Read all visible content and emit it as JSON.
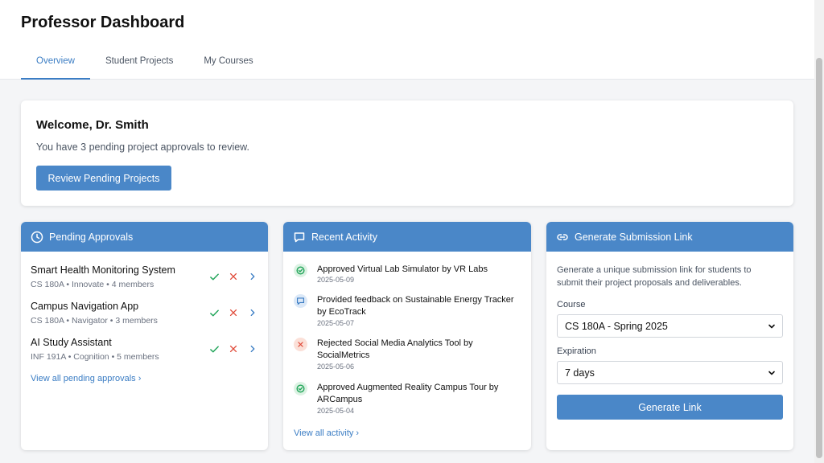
{
  "header": {
    "title": "Professor Dashboard",
    "tabs": [
      {
        "label": "Overview"
      },
      {
        "label": "Student Projects"
      },
      {
        "label": "My Courses"
      }
    ]
  },
  "welcome": {
    "title": "Welcome, Dr. Smith",
    "message": "You have 3 pending project approvals to review.",
    "button_label": "Review Pending Projects"
  },
  "pending": {
    "title": "Pending Approvals",
    "items": [
      {
        "name": "Smart Health Monitoring System",
        "meta": "CS 180A • Innovate • 4 members"
      },
      {
        "name": "Campus Navigation App",
        "meta": "CS 180A • Navigator • 3 members"
      },
      {
        "name": "AI Study Assistant",
        "meta": "INF 191A • Cognition • 5 members"
      }
    ],
    "view_all": "View all pending approvals ›"
  },
  "activity": {
    "title": "Recent Activity",
    "items": [
      {
        "text": "Approved Virtual Lab Simulator by VR Labs",
        "date": "2025-05-09",
        "type": "approved"
      },
      {
        "text": "Provided feedback on Sustainable Energy Tracker by EcoTrack",
        "date": "2025-05-07",
        "type": "feedback"
      },
      {
        "text": "Rejected Social Media Analytics Tool by SocialMetrics",
        "date": "2025-05-06",
        "type": "rejected"
      },
      {
        "text": "Approved Augmented Reality Campus Tour by ARCampus",
        "date": "2025-05-04",
        "type": "approved"
      }
    ],
    "view_all": "View all activity ›"
  },
  "submission": {
    "title": "Generate Submission Link",
    "description": "Generate a unique submission link for students to submit their project proposals and deliverables.",
    "course_label": "Course",
    "course_value": "CS 180A - Spring 2025",
    "expiration_label": "Expiration",
    "expiration_value": "7 days",
    "button_label": "Generate Link"
  },
  "colors": {
    "accent": "#4a87c8",
    "approve": "#22a55a",
    "reject": "#e04b3a",
    "navigate": "#3b7dc4"
  }
}
